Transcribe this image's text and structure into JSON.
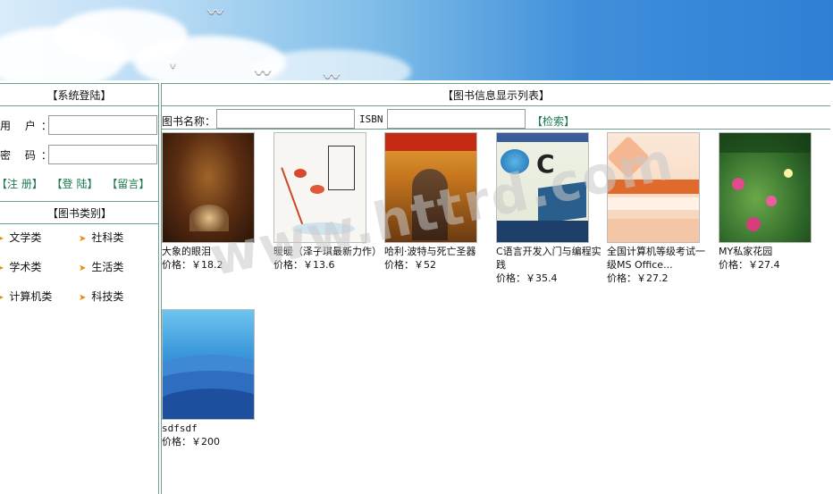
{
  "login": {
    "title": "【系统登陆】",
    "username_label": "用 户：",
    "password_label": "密 码：",
    "links": [
      "【注 册】",
      "【登 陆】",
      "【留言】"
    ]
  },
  "categories": {
    "title": "【图书类别】",
    "items": [
      "文学类",
      "社科类",
      "学术类",
      "生活类",
      "计算机类",
      "科技类"
    ]
  },
  "main": {
    "title": "【图书信息显示列表】",
    "search": {
      "name_label": "图书名称：",
      "isbn_label": "ISBN",
      "button": "【检索】",
      "name_value": "",
      "isbn_value": ""
    },
    "books": [
      {
        "title": "大象的眼泪",
        "price": "价格：￥18.2"
      },
      {
        "title": "暖暖（泽子琪最新力作）",
        "price": "价格：￥13.6"
      },
      {
        "title": "哈利·波特与死亡圣器",
        "price": "价格：￥52"
      },
      {
        "title": "C语言开发入门与编程实践",
        "price": "价格：￥35.4"
      },
      {
        "title": "全国计算机等级考试一级MS Office...",
        "price": "价格：￥27.2"
      },
      {
        "title": "MY私家花园",
        "price": "价格：￥27.4"
      },
      {
        "title": "sdfsdf",
        "price": "价格：￥200"
      }
    ]
  },
  "watermark": "www.httrd.com"
}
